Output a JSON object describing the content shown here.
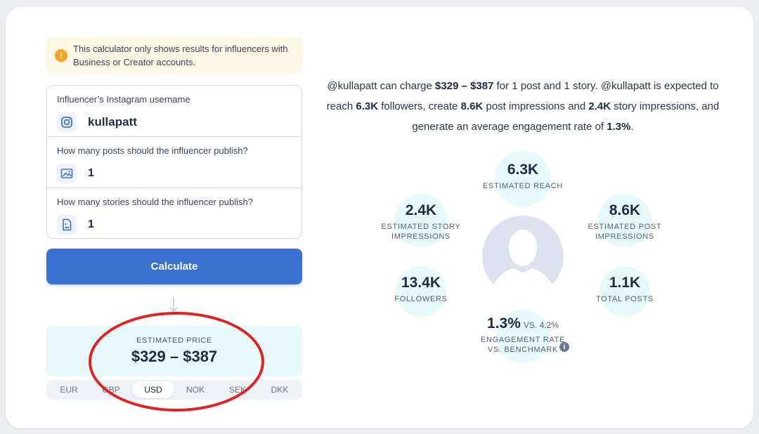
{
  "notice": {
    "icon": "info-icon",
    "text": "This calculator only shows results for influencers with Business or Creator accounts."
  },
  "form": {
    "username": {
      "label": "Influencer’s Instagram username",
      "value": "kullapatt",
      "icon": "instagram-icon"
    },
    "posts": {
      "label": "How many posts should the influencer publish?",
      "value": "1",
      "icon": "image-icon"
    },
    "stories": {
      "label": "How many stories should the influencer publish?",
      "value": "1",
      "icon": "story-icon"
    }
  },
  "calculate_label": "Calculate",
  "price": {
    "label": "ESTIMATED PRICE",
    "value": "$329 – $387"
  },
  "currencies": [
    "EUR",
    "GBP",
    "USD",
    "NOK",
    "SEK",
    "DKK"
  ],
  "selected_currency": "USD",
  "summary": {
    "s1": "@kullapatt can charge ",
    "b1": "$329 – $387",
    "s2": " for 1 post and 1 story. @kullapatt is expected to reach ",
    "b2": "6.3K",
    "s3": " followers, create ",
    "b3": "8.6K",
    "s4": " post impressions and ",
    "b4": "2.4K",
    "s5": " story impressions, and generate an average engagement rate of ",
    "b5": "1.3%",
    "s6": "."
  },
  "stats": {
    "reach": {
      "value": "6.3K",
      "label": "ESTIMATED REACH"
    },
    "story": {
      "value": "2.4K",
      "label1": "ESTIMATED STORY",
      "label2": "IMPRESSIONS"
    },
    "post": {
      "value": "8.6K",
      "label1": "ESTIMATED POST",
      "label2": "IMPRESSIONS"
    },
    "followers": {
      "value": "13.4K",
      "label": "FOLLOWERS"
    },
    "total_posts": {
      "value": "1.1K",
      "label": "TOTAL POSTS"
    },
    "engagement": {
      "value": "1.3%",
      "vs": "VS. 4.2%",
      "label1": "ENGAGEMENT RATE",
      "label2": "VS. BENCHMARK"
    }
  },
  "colors": {
    "accent": "#3b72d1",
    "notice_bg": "#fdf6e4",
    "stat_circle": "#e6f9fb",
    "highlight": "#e02222"
  }
}
